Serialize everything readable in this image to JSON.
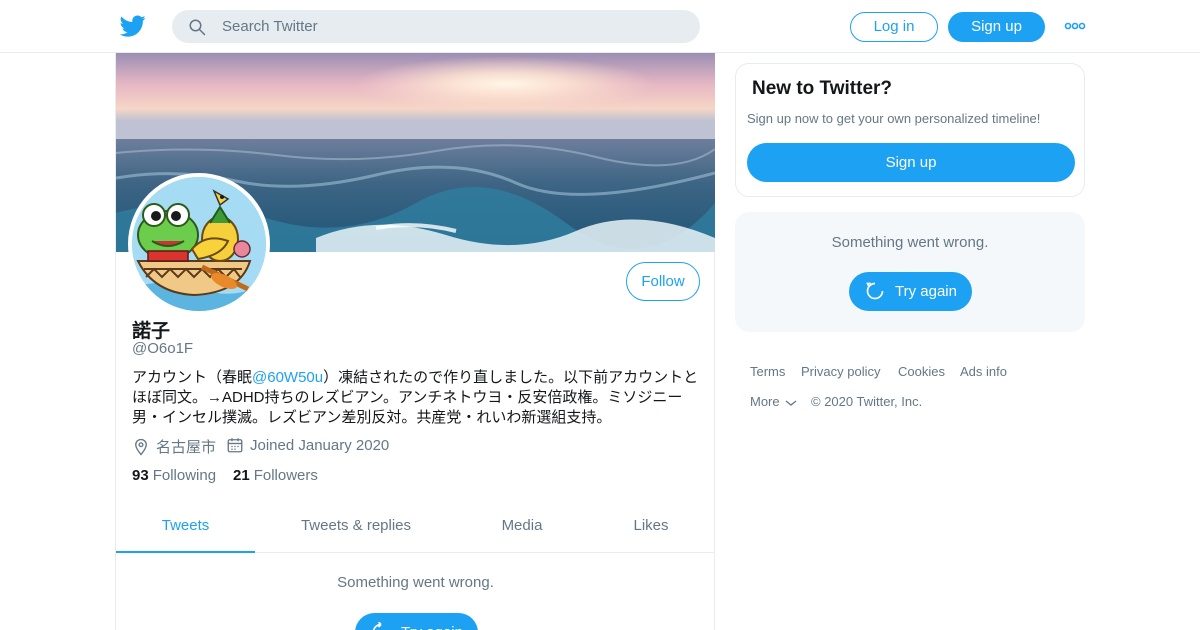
{
  "header": {
    "search_placeholder": "Search Twitter",
    "login_label": "Log in",
    "signup_label": "Sign up"
  },
  "profile": {
    "follow_label": "Follow",
    "name": "諾子",
    "handle": "@O6o1F",
    "bio_before": "アカウント（春眠",
    "bio_link": "@60W50u",
    "bio_after": "）凍結されたので作り直しました。以下前アカウントとほぼ同文。→ADHD持ちのレズビアン。アンチネトウヨ・反安倍政権。ミソジニー男・インセル撲滅。レズビアン差別反対。共産党・れいわ新選組支持。",
    "location": "名古屋市",
    "joined": "Joined January 2020",
    "following_count": "93",
    "following_label": "Following",
    "followers_count": "21",
    "followers_label": "Followers"
  },
  "tabs": [
    {
      "label": "Tweets",
      "active": true
    },
    {
      "label": "Tweets & replies",
      "active": false
    },
    {
      "label": "Media",
      "active": false
    },
    {
      "label": "Likes",
      "active": false
    }
  ],
  "timeline": {
    "error_message": "Something went wrong.",
    "retry_label": "Try again"
  },
  "sidebar": {
    "new_title": "New to Twitter?",
    "new_subtitle": "Sign up now to get your own personalized timeline!",
    "signup_label": "Sign up",
    "error_message": "Something went wrong.",
    "retry_label": "Try again"
  },
  "footer": {
    "terms": "Terms",
    "privacy": "Privacy policy",
    "cookies": "Cookies",
    "ads": "Ads info",
    "more": "More",
    "copyright": "© 2020 Twitter, Inc."
  },
  "colors": {
    "accent": "#1da1f2",
    "muted_text": "#657786",
    "border": "#e6ecf0"
  },
  "icons": [
    "twitter-bird-icon",
    "search-icon",
    "more-dots-icon",
    "location-icon",
    "calendar-icon",
    "refresh-icon",
    "chevron-down-icon"
  ]
}
